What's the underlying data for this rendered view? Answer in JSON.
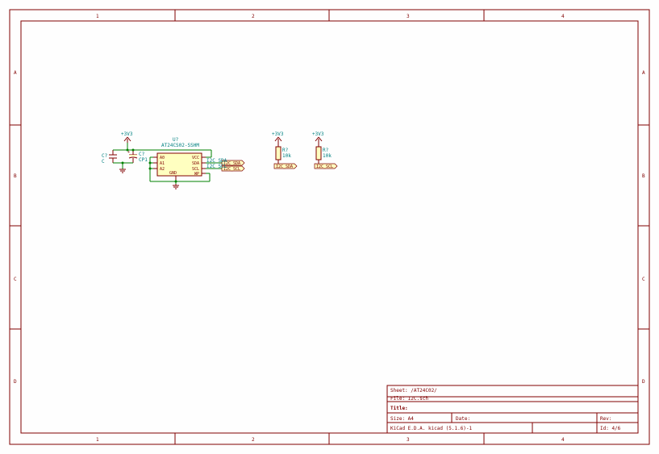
{
  "frame": {
    "corners": [
      "1",
      "2",
      "3",
      "4"
    ],
    "side_letters": [
      "A",
      "B",
      "C",
      "D"
    ]
  },
  "power": {
    "v3v3_1": "+3V3",
    "v3v3_2": "+3V3",
    "v3v3_3": "+3V3"
  },
  "caps": {
    "c1_ref": "C?",
    "c1_val": "C",
    "c2_ref": "C?",
    "c2_val": "CP1"
  },
  "ic": {
    "ref": "U?",
    "value": "AT24CS02-SSHM",
    "pins": {
      "a0": "A0",
      "a1": "A1",
      "a2": "A2",
      "gnd": "GND",
      "sda": "SDA",
      "scl": "SCL",
      "wp": "WP",
      "vcc": "VCC"
    }
  },
  "resistors": {
    "r1_ref": "R?",
    "r1_val": "10k",
    "r2_ref": "R?",
    "r2_val": "10k"
  },
  "netlabels": {
    "sda1": "I2C_SDA",
    "scl1": "I2C_SCL",
    "sda2": "I2C_SDA",
    "scl2": "I2C_SCL"
  },
  "titleblock": {
    "sheet": "Sheet: /AT24C02/",
    "file": "File: I2C.sch",
    "title_lbl": "Title:",
    "size": "Size: A4",
    "date": "Date:",
    "rev": "Rev:",
    "kicad": "KiCad E.D.A.  kicad (5.1.6)-1",
    "id": "Id: 4/6"
  }
}
